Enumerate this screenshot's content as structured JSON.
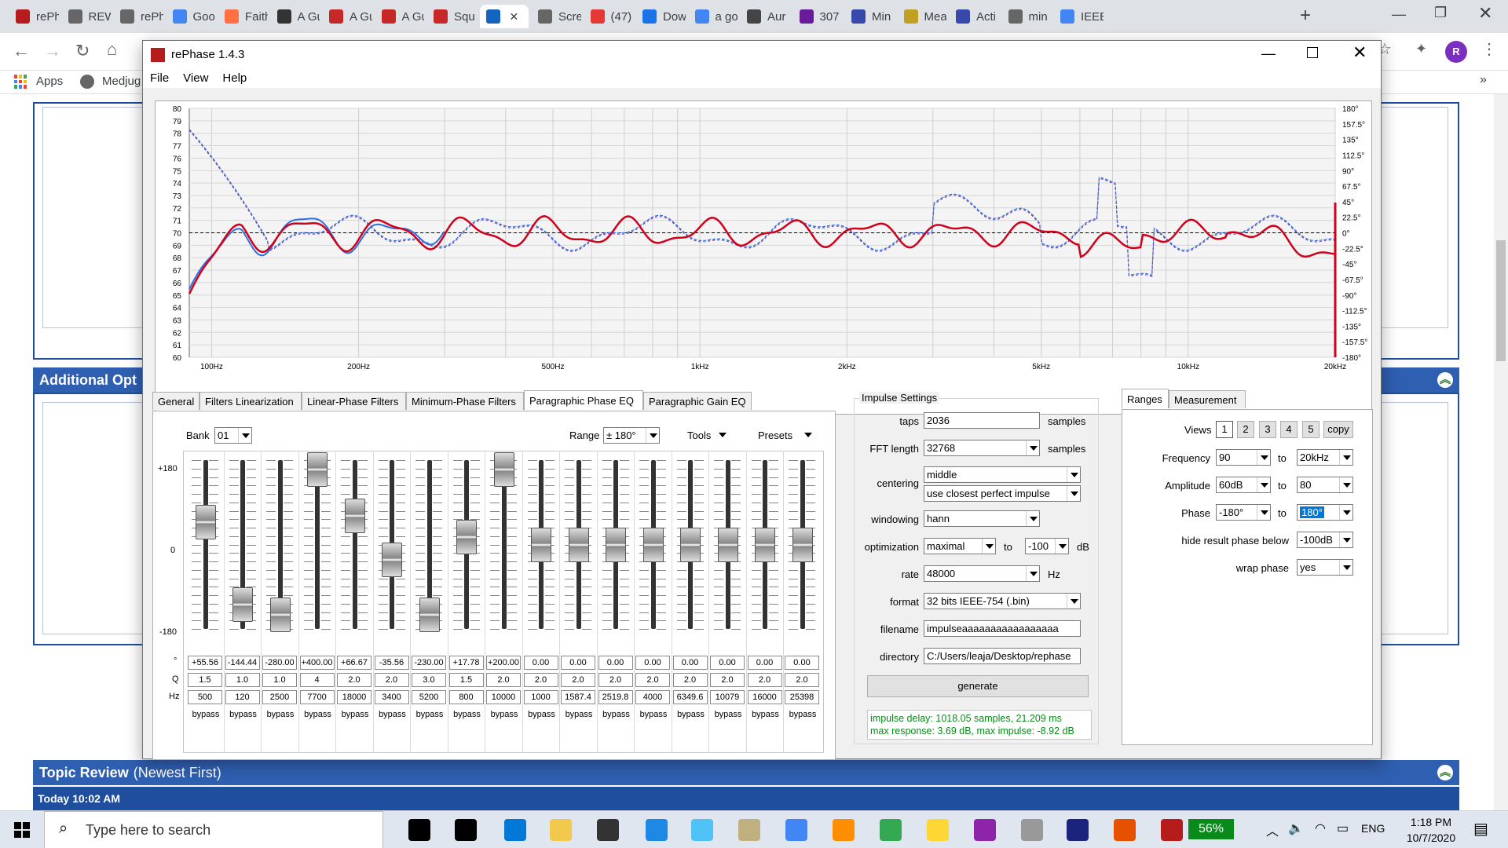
{
  "browser": {
    "tabs": [
      "rePh",
      "REW",
      "rePh",
      "Goo",
      "Faith",
      "A Gu",
      "A Gu",
      "A Gu",
      "Squ",
      "",
      "Scre",
      "(47)",
      "Dow",
      "a go",
      "Aur",
      "307",
      "Min",
      "Mea",
      "Acti",
      "min",
      "IEEE"
    ],
    "bookmarks": {
      "apps": "Apps",
      "medjug": "Medjug"
    },
    "avatar": "R"
  },
  "webpage": {
    "additional_options": "Additional Opt",
    "topic_review": "Topic Review",
    "topic_review_sub": "(Newest First)",
    "today": "Today 10:02 AM"
  },
  "window": {
    "title": "rePhase 1.4.3",
    "menu": [
      "File",
      "View",
      "Help"
    ]
  },
  "graph": {
    "y_left": [
      "80",
      "79",
      "78",
      "77",
      "76",
      "75",
      "74",
      "73",
      "72",
      "71",
      "70",
      "69",
      "68",
      "67",
      "66",
      "65",
      "64",
      "63",
      "62",
      "61",
      "60"
    ],
    "y_right": [
      "180°",
      "157.5°",
      "135°",
      "112.5°",
      "90°",
      "67.5°",
      "45°",
      "22.5°",
      "0°",
      "-22.5°",
      "-45°",
      "-67.5°",
      "-90°",
      "-112.5°",
      "-135°",
      "-157.5°",
      "-180°"
    ],
    "x_labels": [
      "100Hz",
      "200Hz",
      "500Hz",
      "1kHz",
      "2kHz",
      "5kHz",
      "10kHz",
      "20kHz"
    ]
  },
  "tabs": [
    "General",
    "Filters Linearization",
    "Linear-Phase Filters",
    "Minimum-Phase Filters",
    "Paragraphic Phase EQ",
    "Paragraphic Gain EQ"
  ],
  "peq": {
    "bank_label": "Bank",
    "bank_value": "01",
    "range_label": "Range",
    "range_value": "± 180°",
    "tools": "Tools",
    "presets": "Presets",
    "scale_top": "+180",
    "scale_mid": "0",
    "scale_bot": "-180",
    "row_labels": {
      "deg": "°",
      "q": "Q",
      "hz": "Hz"
    },
    "bypass": "bypass",
    "bands": [
      {
        "deg": "+55.56",
        "q": "1.5",
        "hz": "500",
        "pos": 0.35
      },
      {
        "deg": "-144.44",
        "q": "1.0",
        "hz": "120",
        "pos": 0.9
      },
      {
        "deg": "-280.00",
        "q": "1.0",
        "hz": "2500",
        "pos": 0.97
      },
      {
        "deg": "+400.00",
        "q": "4",
        "hz": "7700",
        "pos": 0.0
      },
      {
        "deg": "+66.67",
        "q": "2.0",
        "hz": "18000",
        "pos": 0.31
      },
      {
        "deg": "-35.56",
        "q": "2.0",
        "hz": "3400",
        "pos": 0.6
      },
      {
        "deg": "-230.00",
        "q": "3.0",
        "hz": "5200",
        "pos": 0.97
      },
      {
        "deg": "+17.78",
        "q": "1.5",
        "hz": "800",
        "pos": 0.45
      },
      {
        "deg": "+200.00",
        "q": "2.0",
        "hz": "10000",
        "pos": 0.0
      },
      {
        "deg": "0.00",
        "q": "2.0",
        "hz": "1000",
        "pos": 0.5
      },
      {
        "deg": "0.00",
        "q": "2.0",
        "hz": "1587.4",
        "pos": 0.5
      },
      {
        "deg": "0.00",
        "q": "2.0",
        "hz": "2519.8",
        "pos": 0.5
      },
      {
        "deg": "0.00",
        "q": "2.0",
        "hz": "4000",
        "pos": 0.5
      },
      {
        "deg": "0.00",
        "q": "2.0",
        "hz": "6349.6",
        "pos": 0.5
      },
      {
        "deg": "0.00",
        "q": "2.0",
        "hz": "10079",
        "pos": 0.5
      },
      {
        "deg": "0.00",
        "q": "2.0",
        "hz": "16000",
        "pos": 0.5
      },
      {
        "deg": "0.00",
        "q": "2.0",
        "hz": "25398",
        "pos": 0.5
      }
    ]
  },
  "impulse": {
    "title": "Impulse Settings",
    "taps_label": "taps",
    "taps": "2036",
    "taps_unit": "samples",
    "fft_label": "FFT length",
    "fft": "32768",
    "fft_unit": "samples",
    "centering_label": "centering",
    "centering": "middle",
    "centering2": "use closest perfect impulse",
    "windowing_label": "windowing",
    "windowing": "hann",
    "optimization_label": "optimization",
    "optimization": "maximal",
    "opt_to": "to",
    "opt_db": "-100",
    "opt_unit": "dB",
    "rate_label": "rate",
    "rate": "48000",
    "rate_unit": "Hz",
    "format_label": "format",
    "format": "32 bits IEEE-754 (.bin)",
    "filename_label": "filename",
    "filename": "impulseaaaaaaaaaaaaaaaaa",
    "directory_label": "directory",
    "directory": "C:/Users/leaja/Desktop/rephase",
    "generate": "generate",
    "info1": "impulse delay: 1018.05 samples, 21.209 ms",
    "info2": "max response: 3.69 dB, max impulse: -8.92 dB"
  },
  "ranges": {
    "tabs": [
      "Ranges",
      "Measurement"
    ],
    "views_label": "Views",
    "views": [
      "1",
      "2",
      "3",
      "4",
      "5"
    ],
    "copy": "copy",
    "freq_label": "Frequency",
    "freq_from": "90",
    "freq_to": "20kHz",
    "amp_label": "Amplitude",
    "amp_from": "60dB",
    "amp_to": "80",
    "phase_label": "Phase",
    "phase_from": "-180°",
    "phase_to": "180°",
    "to": "to",
    "hide_label": "hide result phase below",
    "hide_value": "-100dB",
    "wrap_label": "wrap phase",
    "wrap_value": "yes"
  },
  "taskbar": {
    "search": "Type here to search",
    "battery": "56%",
    "lang": "ENG",
    "time": "1:18 PM",
    "date": "10/7/2020"
  },
  "colors": {
    "red": "#d0021b",
    "blue": "#2f6fe0",
    "purple": "#7a4ca0",
    "accent": "#1a73e8"
  }
}
